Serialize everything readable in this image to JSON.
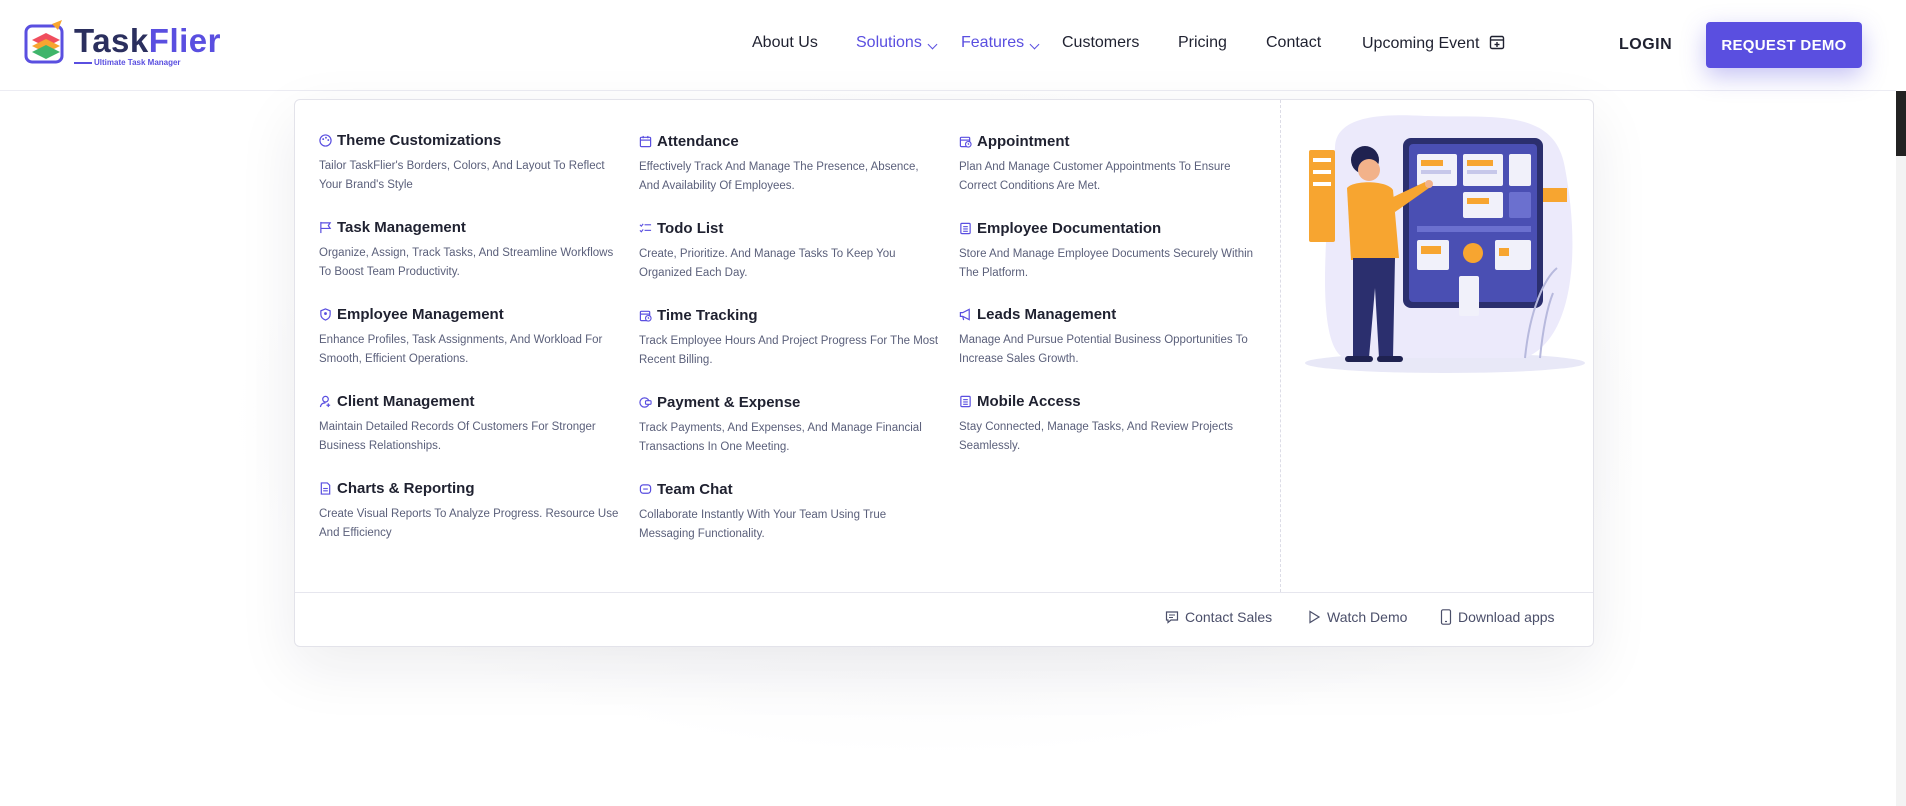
{
  "brand": {
    "name_part1": "Task",
    "name_part2": "Flier",
    "tagline": "Ultimate Task Manager"
  },
  "nav": {
    "items": [
      {
        "label": "About Us"
      },
      {
        "label": "Solutions"
      },
      {
        "label": "Features"
      },
      {
        "label": "Customers"
      },
      {
        "label": "Pricing"
      },
      {
        "label": "Contact"
      },
      {
        "label": "Upcoming Event"
      }
    ],
    "login": "LOGIN",
    "request_demo": "REQUEST DEMO"
  },
  "features": {
    "col1": [
      {
        "title": "Theme Customizations",
        "desc": "Tailor TaskFlier's Borders, Colors, And Layout To Reflect Your Brand's Style",
        "icon": "palette-icon"
      },
      {
        "title": "Task Management",
        "desc": "Organize, Assign, Track Tasks, And Streamline Workflows To Boost Team Productivity.",
        "icon": "flag-icon"
      },
      {
        "title": "Employee Management",
        "desc": "Enhance Profiles, Task Assignments, And Workload For Smooth, Efficient Operations.",
        "icon": "shield-user-icon"
      },
      {
        "title": "Client Management",
        "desc": "Maintain Detailed Records Of Customers For Stronger Business Relationships.",
        "icon": "user-icon"
      },
      {
        "title": "Charts & Reporting",
        "desc": "Create Visual Reports To Analyze Progress. Resource Use And Efficiency",
        "icon": "report-icon"
      }
    ],
    "col2": [
      {
        "title": "Attendance",
        "desc": "Effectively Track And Manage The Presence, Absence, And Availability Of Employees.",
        "icon": "calendar-icon"
      },
      {
        "title": "Todo List",
        "desc": "Create, Prioritize. And Manage Tasks To Keep You Organized Each Day.",
        "icon": "checklist-icon"
      },
      {
        "title": "Time Tracking",
        "desc": "Track Employee Hours And Project Progress For The Most Recent Billing.",
        "icon": "calendar-clock-icon"
      },
      {
        "title": "Payment & Expense",
        "desc": "Track Payments, And Expenses, And Manage Financial Transactions In One Meeting.",
        "icon": "payment-icon"
      },
      {
        "title": "Team Chat",
        "desc": "Collaborate Instantly With Your Team Using True Messaging Functionality.",
        "icon": "chat-icon"
      }
    ],
    "col3": [
      {
        "title": "Appointment",
        "desc": "Plan And Manage Customer Appointments To Ensure Correct Conditions Are Met.",
        "icon": "calendar-clock-icon"
      },
      {
        "title": "Employee Documentation",
        "desc": "Store And Manage Employee Documents Securely Within The Platform.",
        "icon": "document-icon"
      },
      {
        "title": "Leads Management",
        "desc": "Manage And Pursue Potential Business Opportunities To Increase Sales Growth.",
        "icon": "megaphone-icon"
      },
      {
        "title": "Mobile Access",
        "desc": "Stay Connected, Manage Tasks, And Review Projects Seamlessly.",
        "icon": "document-icon"
      }
    ]
  },
  "footer_links": {
    "contact_sales": "Contact Sales",
    "watch_demo": "Watch Demo",
    "download_apps": "Download apps"
  },
  "colors": {
    "accent": "#5a4fe0",
    "illustration_orange": "#f7a530",
    "illustration_navy": "#2b2f6e"
  }
}
